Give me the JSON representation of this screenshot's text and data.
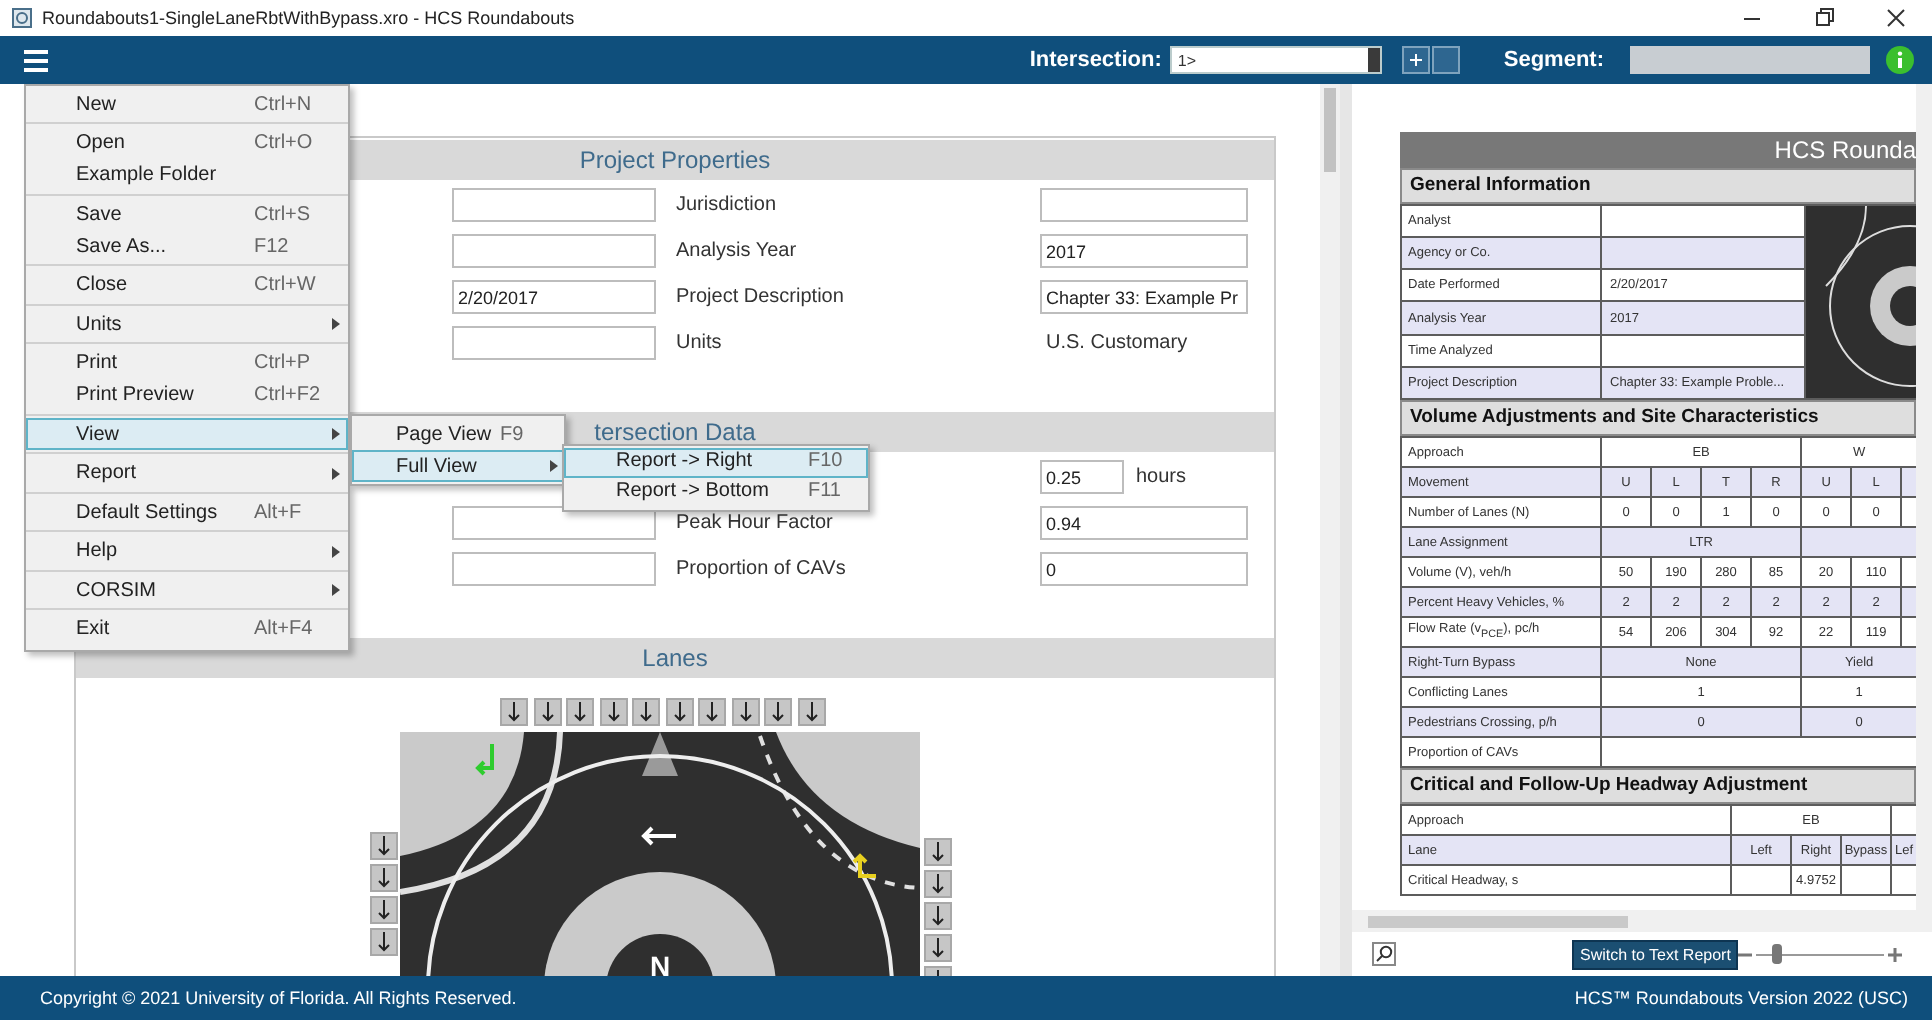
{
  "title_bar": {
    "title": "Roundabouts1-SingleLaneRbtWithBypass.xro - HCS Roundabouts"
  },
  "header": {
    "intersection_label": "Intersection:",
    "intersection_value": "1>",
    "segment_label": "Segment:"
  },
  "menu": {
    "groups": [
      [
        {
          "label": "New",
          "shortcut": "Ctrl+N",
          "submenu": false,
          "selected": false
        }
      ],
      [
        {
          "label": "Open",
          "shortcut": "Ctrl+O",
          "submenu": false,
          "selected": false
        },
        {
          "label": "Example Folder",
          "submenu": false,
          "selected": false
        }
      ],
      [
        {
          "label": "Save",
          "shortcut": "Ctrl+S",
          "submenu": false,
          "selected": false
        },
        {
          "label": "Save As...",
          "shortcut": "F12",
          "submenu": false,
          "selected": false
        }
      ],
      [
        {
          "label": "Close",
          "shortcut": "Ctrl+W",
          "submenu": false,
          "selected": false
        }
      ],
      [
        {
          "label": "Units",
          "submenu": true,
          "selected": false
        }
      ],
      [
        {
          "label": "Print",
          "shortcut": "Ctrl+P",
          "submenu": false,
          "selected": false
        },
        {
          "label": "Print Preview",
          "shortcut": "Ctrl+F2",
          "submenu": false,
          "selected": false
        }
      ],
      [
        {
          "label": "View",
          "submenu": true,
          "selected": true
        }
      ],
      [
        {
          "label": "Report",
          "submenu": true,
          "selected": false
        }
      ],
      [
        {
          "label": "Default Settings",
          "shortcut": "Alt+F",
          "submenu": false,
          "selected": false
        }
      ],
      [
        {
          "label": "Help",
          "submenu": true,
          "selected": false
        }
      ],
      [
        {
          "label": "CORSIM",
          "submenu": true,
          "selected": false
        }
      ],
      [
        {
          "label": "Exit",
          "shortcut": "Alt+F4",
          "submenu": false,
          "selected": false
        }
      ]
    ]
  },
  "view_submenu": {
    "items": [
      {
        "label": "Page View",
        "shortcut": "F9",
        "submenu": false,
        "selected": false
      },
      {
        "label": "Full View",
        "submenu": true,
        "selected": true
      }
    ]
  },
  "full_view_submenu": {
    "items": [
      {
        "label": "Report -> Right",
        "shortcut": "F10",
        "submenu": false,
        "selected": true
      },
      {
        "label": "Report -> Bottom",
        "shortcut": "F11",
        "submenu": false,
        "selected": false
      }
    ]
  },
  "form": {
    "sections": [
      {
        "kind": "fields",
        "title": "Project Properties",
        "rows": [
          {
            "left": {
              "kind": "field"
            },
            "label": "Jurisdiction",
            "right": {
              "kind": "field"
            }
          },
          {
            "left": {
              "kind": "field"
            },
            "label": "Analysis Year",
            "right": {
              "kind": "field",
              "value": "2017"
            }
          },
          {
            "left": {
              "kind": "field",
              "value": "2/20/2017"
            },
            "label": "Project Description",
            "right": {
              "kind": "field",
              "value": "Chapter 33: Example Pr"
            }
          },
          {
            "left": {
              "kind": "field"
            },
            "label": "Units",
            "right": {
              "kind": "text",
              "value": "U.S. Customary"
            }
          }
        ]
      },
      {
        "kind": "fields",
        "title": "tersection Data",
        "rows": [
          {
            "right": {
              "kind": "short_field",
              "value": "0.25",
              "unit": "hours"
            }
          },
          {
            "left": {
              "kind": "field"
            },
            "label": "Peak Hour Factor",
            "right": {
              "kind": "field",
              "value": "0.94"
            }
          },
          {
            "left": {
              "kind": "field"
            },
            "label": "Proportion of CAVs",
            "right": {
              "kind": "field",
              "value": "0"
            }
          }
        ]
      },
      {
        "kind": "lanes",
        "title": "Lanes",
        "north_label": "N"
      }
    ]
  },
  "report": {
    "title": "HCS Rounda",
    "general": {
      "title": "General Information",
      "rows": [
        {
          "label": "Analyst"
        },
        {
          "label": "Agency or Co."
        },
        {
          "label": "Date Performed",
          "value": "2/20/2017"
        },
        {
          "label": "Analysis Year",
          "value": "2017"
        },
        {
          "label": "Time Analyzed"
        },
        {
          "label": "Project Description",
          "value": "Chapter 33: Example Proble..."
        }
      ]
    },
    "volume": {
      "title": "Volume Adjustments and Site Characteristics",
      "rows": [
        {
          "label": "Approach",
          "cells": [
            {
              "text": "EB",
              "colspan": 4
            },
            {
              "text": "W",
              "colspan": 3
            }
          ]
        },
        {
          "label": "Movement",
          "cells": [
            {
              "text": "U"
            },
            {
              "text": "L"
            },
            {
              "text": "T"
            },
            {
              "text": "R"
            },
            {
              "text": "U"
            },
            {
              "text": "L"
            },
            {}
          ]
        },
        {
          "label": "Number of Lanes (N)",
          "cells": [
            {
              "text": "0"
            },
            {
              "text": "0"
            },
            {
              "text": "1"
            },
            {
              "text": "0"
            },
            {
              "text": "0"
            },
            {
              "text": "0"
            },
            {}
          ]
        },
        {
          "label": "Lane Assignment",
          "cells": [
            {
              "text": "LTR",
              "colspan": 4
            },
            {
              "colspan": 3
            }
          ]
        },
        {
          "label": "Volume (V), veh/h",
          "cells": [
            {
              "text": "50"
            },
            {
              "text": "190"
            },
            {
              "text": "280"
            },
            {
              "text": "85"
            },
            {
              "text": "20"
            },
            {
              "text": "110"
            },
            {}
          ]
        },
        {
          "label": "Percent Heavy Vehicles, %",
          "cells": [
            {
              "text": "2"
            },
            {
              "text": "2"
            },
            {
              "text": "2"
            },
            {
              "text": "2"
            },
            {
              "text": "2"
            },
            {
              "text": "2"
            },
            {}
          ]
        },
        {
          "label": "Flow Rate (v$_{PCE}$), pc/h",
          "cells": [
            {
              "text": "54"
            },
            {
              "text": "206"
            },
            {
              "text": "304"
            },
            {
              "text": "92"
            },
            {
              "text": "22"
            },
            {
              "text": "119"
            },
            {}
          ]
        },
        {
          "label": "Right-Turn Bypass",
          "cells": [
            {
              "text": "None",
              "colspan": 4
            },
            {
              "text": "Yield",
              "colspan": 3
            }
          ]
        },
        {
          "label": "Conflicting Lanes",
          "cells": [
            {
              "text": "1",
              "colspan": 4
            },
            {
              "text": "1",
              "colspan": 3
            }
          ]
        },
        {
          "label": "Pedestrians Crossing, p/h",
          "cells": [
            {
              "text": "0",
              "colspan": 4
            },
            {
              "text": "0",
              "colspan": 3
            }
          ]
        },
        {
          "label": "Proportion of CAVs",
          "cells": [
            {
              "colspan": 7
            }
          ]
        }
      ]
    },
    "critical": {
      "title": "Critical and Follow-Up Headway Adjustment",
      "rows": [
        {
          "label": "Approach",
          "cells": [
            {
              "text": "EB",
              "colspan": 3
            },
            {}
          ]
        },
        {
          "label": "Lane",
          "cells": [
            {
              "text": "Left"
            },
            {
              "text": "Right"
            },
            {
              "text": "Bypass"
            },
            {
              "text": "Lef"
            }
          ]
        },
        {
          "label": "Critical Headway, s",
          "cells": [
            {},
            {
              "text": "4.9752"
            },
            {},
            {}
          ]
        }
      ]
    },
    "switch_button": "Switch to Text Report",
    "zoom_slider": {
      "level": 0.15
    }
  },
  "footer": {
    "copyright": "Copyright © 2021 University of Florida. All Rights Reserved.",
    "version": "HCS™ Roundabouts Version 2022 (USC)"
  }
}
